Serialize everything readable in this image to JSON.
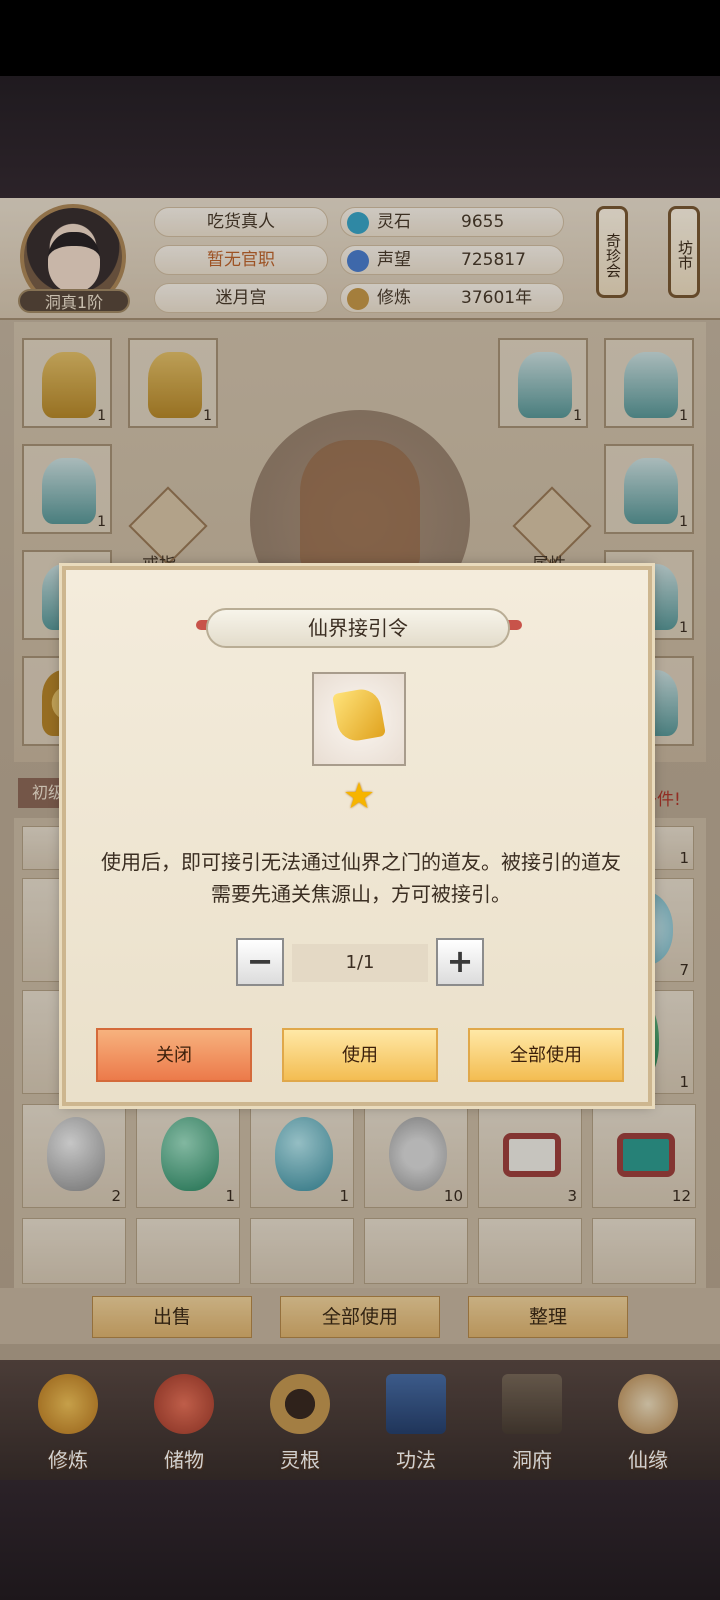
{
  "header": {
    "player_name": "吃货真人",
    "official_post": "暂无官职",
    "sect": "迷月宫",
    "realm_badge": "洞真1阶",
    "resources": [
      {
        "label": "灵石",
        "value": "9655",
        "icon": "spirit-stone-icon"
      },
      {
        "label": "声望",
        "value": "725817",
        "icon": "reputation-icon"
      },
      {
        "label": "修炼",
        "value": "37601年",
        "icon": "cultivation-icon"
      }
    ],
    "side_buttons": [
      "奇珍会",
      "坊市"
    ]
  },
  "equipment": {
    "ring_label": "戒指",
    "attr_label": "属性",
    "slot_counts": [
      "1",
      "1",
      "1",
      "1",
      "1",
      "1",
      "1",
      "1"
    ]
  },
  "inventory": {
    "tab_label": "初级",
    "hint": "多件!",
    "row_counts": [
      "2",
      "1",
      "1",
      "10",
      "3",
      "12"
    ],
    "partial_counts": [
      "1",
      "7",
      "1"
    ]
  },
  "actions": {
    "sell": "出售",
    "use_all": "全部使用",
    "sort": "整理"
  },
  "nav": [
    {
      "label": "修炼",
      "icon": "cultivate-icon"
    },
    {
      "label": "储物",
      "icon": "storage-bag-icon"
    },
    {
      "label": "灵根",
      "icon": "spirit-root-icon"
    },
    {
      "label": "功法",
      "icon": "technique-book-icon"
    },
    {
      "label": "洞府",
      "icon": "cave-dwelling-icon"
    },
    {
      "label": "仙缘",
      "icon": "immortal-fate-icon"
    }
  ],
  "dialog": {
    "title": "仙界接引令",
    "item_icon": "golden-scroll-icon",
    "description": "使用后，即可接引无法通过仙界之门的道友。被接引的道友需要先通关焦源山，方可被接引。",
    "quantity": "1/1",
    "minus": "−",
    "plus": "+",
    "btn_close": "关闭",
    "btn_use": "使用",
    "btn_use_all": "全部使用"
  },
  "colors": {
    "accent_orange": "#ec7a4a",
    "accent_gold": "#f3bd52",
    "hint_red": "#b3372b"
  }
}
